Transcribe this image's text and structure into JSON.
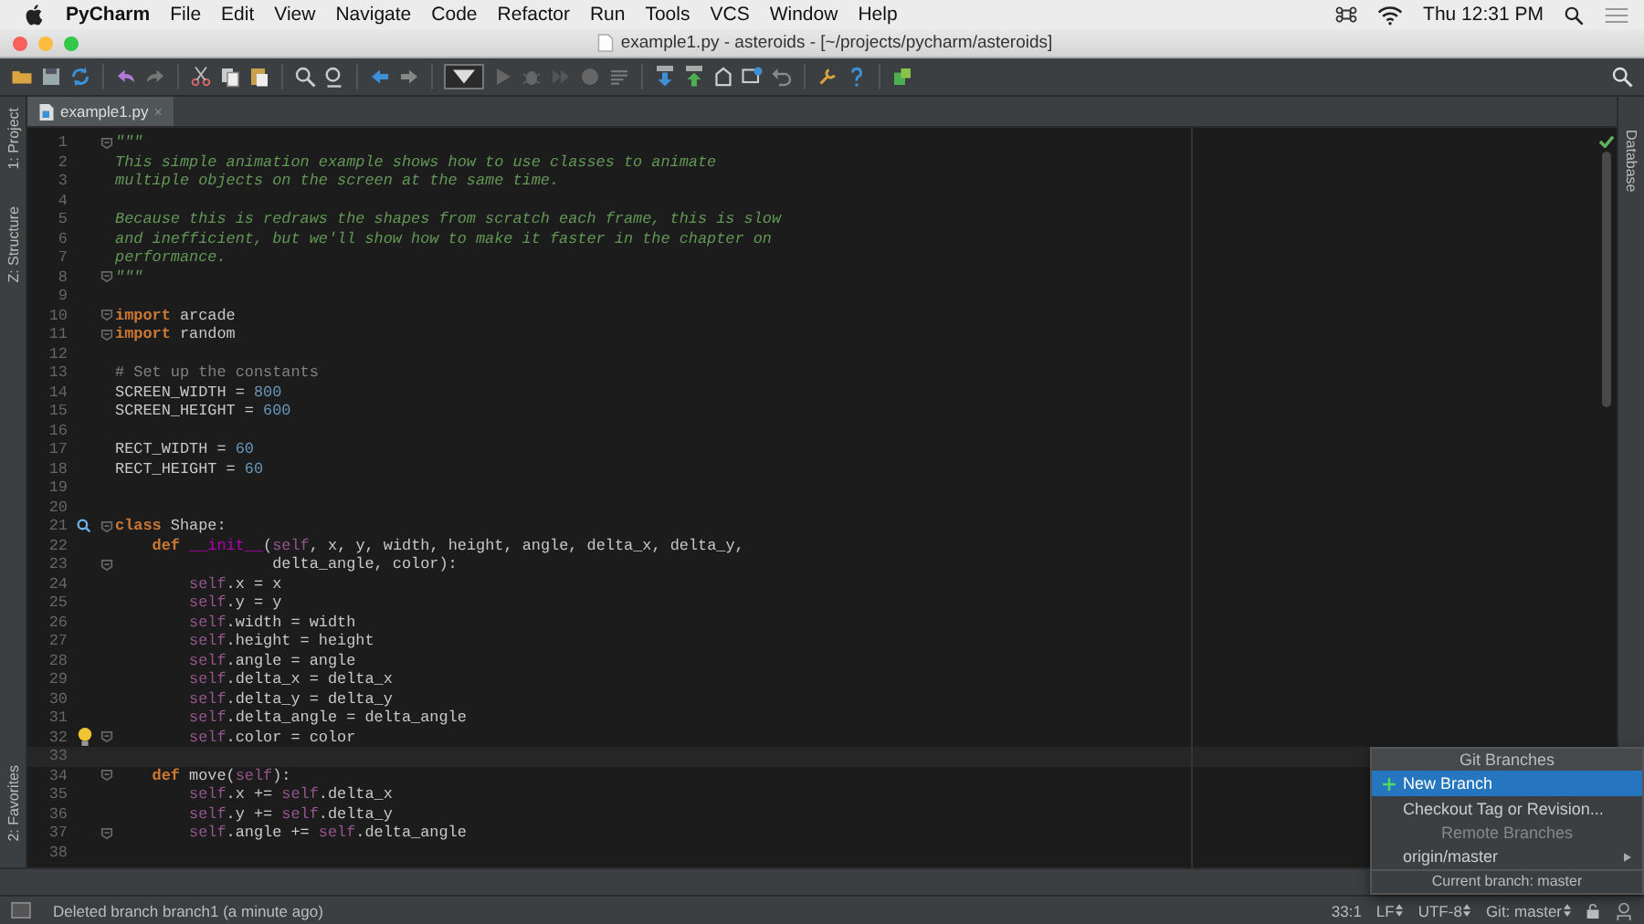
{
  "menubar": {
    "app": "PyCharm",
    "items": [
      "File",
      "Edit",
      "View",
      "Navigate",
      "Code",
      "Refactor",
      "Run",
      "Tools",
      "VCS",
      "Window",
      "Help"
    ],
    "clock": "Thu 12:31 PM"
  },
  "window": {
    "title": "example1.py - asteroids - [~/projects/pycharm/asteroids]"
  },
  "left_tool_tabs": [
    "1: Project",
    "Z: Structure",
    "2: Favorites"
  ],
  "right_tool_tabs": [
    "Database"
  ],
  "tabs": [
    {
      "label": "example1.py",
      "selected": true,
      "close": "×"
    }
  ],
  "editor": {
    "lines": [
      {
        "number": "1",
        "fold": true,
        "current": false,
        "segments": [
          {
            "kind": "doc",
            "text": "\"\"\""
          }
        ]
      },
      {
        "number": "2",
        "fold": false,
        "current": false,
        "segments": [
          {
            "kind": "doc",
            "text": "This simple animation example shows how to use classes to animate"
          }
        ]
      },
      {
        "number": "3",
        "fold": false,
        "current": false,
        "segments": [
          {
            "kind": "doc",
            "text": "multiple objects on the screen at the same time."
          }
        ]
      },
      {
        "number": "4",
        "fold": false,
        "current": false
      },
      {
        "number": "5",
        "fold": false,
        "current": false,
        "segments": [
          {
            "kind": "doc",
            "text": "Because this is redraws the shapes from scratch each frame, this is slow"
          }
        ]
      },
      {
        "number": "6",
        "fold": false,
        "current": false,
        "segments": [
          {
            "kind": "doc",
            "text": "and inefficient, but we'll show how to make it faster in the chapter on"
          }
        ]
      },
      {
        "number": "7",
        "fold": false,
        "current": false,
        "segments": [
          {
            "kind": "doc",
            "text": "performance."
          }
        ]
      },
      {
        "number": "8",
        "fold": true,
        "current": false,
        "segments": [
          {
            "kind": "doc",
            "text": "\"\"\""
          }
        ]
      },
      {
        "number": "9",
        "fold": false,
        "current": false
      },
      {
        "number": "10",
        "fold": true,
        "current": false,
        "segments": [
          {
            "kind": "keyword",
            "text": "import"
          },
          {
            "kind": "plain",
            "text": " arcade"
          }
        ]
      },
      {
        "number": "11",
        "fold": true,
        "current": false,
        "segments": [
          {
            "kind": "keyword",
            "text": "import"
          },
          {
            "kind": "plain",
            "text": " random"
          }
        ]
      },
      {
        "number": "12",
        "fold": false,
        "current": false
      },
      {
        "number": "13",
        "fold": false,
        "current": false,
        "segments": [
          {
            "kind": "comment",
            "text": "# Set up the constants"
          }
        ]
      },
      {
        "number": "14",
        "fold": false,
        "current": false,
        "segments": [
          {
            "kind": "plain",
            "text": "SCREEN_WIDTH = "
          },
          {
            "kind": "number",
            "text": "800"
          }
        ]
      },
      {
        "number": "15",
        "fold": false,
        "current": false,
        "segments": [
          {
            "kind": "plain",
            "text": "SCREEN_HEIGHT = "
          },
          {
            "kind": "number",
            "text": "600"
          }
        ]
      },
      {
        "number": "16",
        "fold": false,
        "current": false
      },
      {
        "number": "17",
        "fold": false,
        "current": false,
        "segments": [
          {
            "kind": "plain",
            "text": "RECT_WIDTH = "
          },
          {
            "kind": "number",
            "text": "60"
          }
        ]
      },
      {
        "number": "18",
        "fold": false,
        "current": false,
        "segments": [
          {
            "kind": "plain",
            "text": "RECT_HEIGHT = "
          },
          {
            "kind": "number",
            "text": "60"
          }
        ]
      },
      {
        "number": "19",
        "fold": false,
        "current": false
      },
      {
        "number": "20",
        "fold": false,
        "current": false
      },
      {
        "number": "21",
        "fold": true,
        "current": false,
        "kind": "override",
        "segments": [
          {
            "kind": "keyword",
            "text": "class"
          },
          {
            "kind": "plain",
            "text": " Shape:"
          }
        ]
      },
      {
        "number": "22",
        "fold": false,
        "current": false,
        "segments": [
          {
            "kind": "keyword",
            "text": "    def "
          },
          {
            "kind": "magic",
            "text": "__init__"
          },
          {
            "kind": "plain",
            "text": "("
          },
          {
            "kind": "self",
            "text": "self"
          },
          {
            "kind": "plain",
            "text": ", x, y, width, height, angle, delta_x, delta_y,"
          }
        ]
      },
      {
        "number": "23",
        "fold": true,
        "current": false,
        "segments": [
          {
            "kind": "plain",
            "text": "                 delta_angle, color):"
          }
        ]
      },
      {
        "number": "24",
        "fold": false,
        "current": false,
        "segments": [
          {
            "kind": "self",
            "text": "        self"
          },
          {
            "kind": "plain",
            "text": ".x = x"
          }
        ]
      },
      {
        "number": "25",
        "fold": false,
        "current": false,
        "segments": [
          {
            "kind": "self",
            "text": "        self"
          },
          {
            "kind": "plain",
            "text": ".y = y"
          }
        ]
      },
      {
        "number": "26",
        "fold": false,
        "current": false,
        "segments": [
          {
            "kind": "self",
            "text": "        self"
          },
          {
            "kind": "plain",
            "text": ".width = width"
          }
        ]
      },
      {
        "number": "27",
        "fold": false,
        "current": false,
        "segments": [
          {
            "kind": "self",
            "text": "        self"
          },
          {
            "kind": "plain",
            "text": ".height = height"
          }
        ]
      },
      {
        "number": "28",
        "fold": false,
        "current": false,
        "segments": [
          {
            "kind": "self",
            "text": "        self"
          },
          {
            "kind": "plain",
            "text": ".angle = angle"
          }
        ]
      },
      {
        "number": "29",
        "fold": false,
        "current": false,
        "segments": [
          {
            "kind": "self",
            "text": "        self"
          },
          {
            "kind": "plain",
            "text": ".delta_x = delta_x"
          }
        ]
      },
      {
        "number": "30",
        "fold": false,
        "current": false,
        "segments": [
          {
            "kind": "self",
            "text": "        self"
          },
          {
            "kind": "plain",
            "text": ".delta_y = delta_y"
          }
        ]
      },
      {
        "number": "31",
        "fold": false,
        "current": false,
        "segments": [
          {
            "kind": "self",
            "text": "        self"
          },
          {
            "kind": "plain",
            "text": ".delta_angle = delta_angle"
          }
        ]
      },
      {
        "number": "32",
        "fold": true,
        "current": false,
        "kind": "bulb",
        "segments": [
          {
            "kind": "self",
            "text": "        self"
          },
          {
            "kind": "plain",
            "text": ".color = color"
          }
        ]
      },
      {
        "number": "33",
        "fold": false,
        "current": true
      },
      {
        "number": "34",
        "fold": true,
        "current": false,
        "segments": [
          {
            "kind": "keyword",
            "text": "    def"
          },
          {
            "kind": "plain",
            "text": " move("
          },
          {
            "kind": "self",
            "text": "self"
          },
          {
            "kind": "plain",
            "text": "):"
          }
        ]
      },
      {
        "number": "35",
        "fold": false,
        "current": false,
        "segments": [
          {
            "kind": "self",
            "text": "        self"
          },
          {
            "kind": "plain",
            "text": ".x += "
          },
          {
            "kind": "self",
            "text": "self"
          },
          {
            "kind": "plain",
            "text": ".delta_x"
          }
        ]
      },
      {
        "number": "36",
        "fold": false,
        "current": false,
        "segments": [
          {
            "kind": "self",
            "text": "        self"
          },
          {
            "kind": "plain",
            "text": ".y += "
          },
          {
            "kind": "self",
            "text": "self"
          },
          {
            "kind": "plain",
            "text": ".delta_y"
          }
        ]
      },
      {
        "number": "37",
        "fold": true,
        "current": false,
        "segments": [
          {
            "kind": "self",
            "text": "        self"
          },
          {
            "kind": "plain",
            "text": ".angle += "
          },
          {
            "kind": "self",
            "text": "self"
          },
          {
            "kind": "plain",
            "text": ".delta_angle"
          }
        ]
      },
      {
        "number": "38",
        "fold": false,
        "current": false
      }
    ]
  },
  "branch_popup": {
    "title": "Git Branches",
    "items": [
      {
        "kind": "create",
        "label": "New Branch",
        "selected": true
      },
      {
        "kind": "action",
        "label": "Checkout Tag or Revision...",
        "selected": false
      },
      {
        "kind": "section",
        "label": "Remote Branches"
      },
      {
        "kind": "branch",
        "label": "origin/master",
        "selected": false
      }
    ],
    "footer": "Current branch: master"
  },
  "status_bar": {
    "message": "Deleted branch branch1 (a minute ago)",
    "position": "33:1",
    "line_separator": "LF",
    "encoding": "UTF-8",
    "vcs": "Git: master"
  }
}
